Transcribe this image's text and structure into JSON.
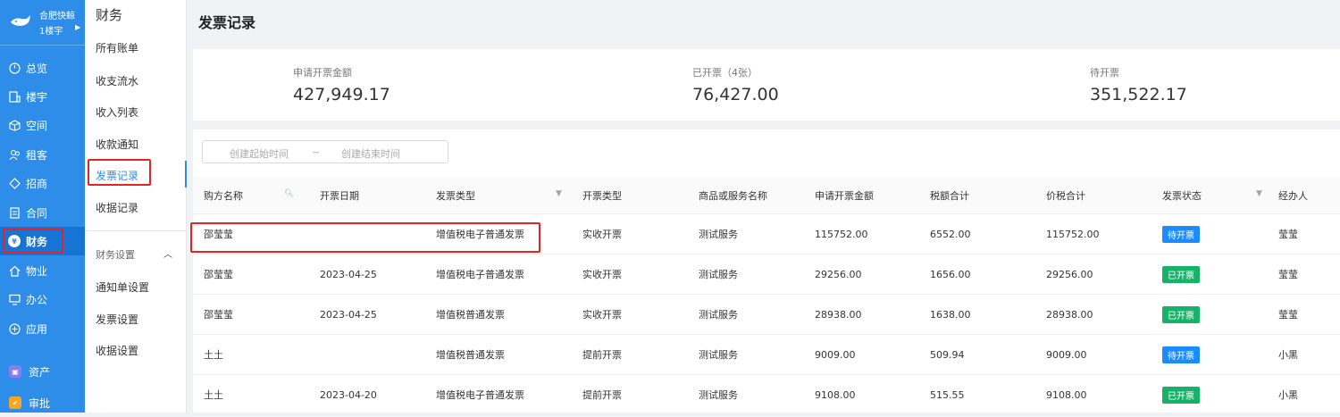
{
  "brand": {
    "name": "合肥快鲸",
    "building": "1楼宇"
  },
  "nav": [
    {
      "label": "总览",
      "icon": "dashboard-icon"
    },
    {
      "label": "楼宇",
      "icon": "building-icon"
    },
    {
      "label": "空间",
      "icon": "cube-icon"
    },
    {
      "label": "租客",
      "icon": "users-icon"
    },
    {
      "label": "招商",
      "icon": "tag-icon"
    },
    {
      "label": "合同",
      "icon": "contract-icon"
    },
    {
      "label": "财务",
      "icon": "finance-icon"
    },
    {
      "label": "物业",
      "icon": "home-icon"
    },
    {
      "label": "办公",
      "icon": "monitor-icon"
    },
    {
      "label": "应用",
      "icon": "apps-icon"
    },
    {
      "label": "资产",
      "icon": "asset-icon"
    },
    {
      "label": "审批",
      "icon": "approve-icon"
    }
  ],
  "submenu": {
    "title": "财务",
    "items": [
      "所有账单",
      "收支流水",
      "收入列表",
      "收款通知",
      "发票记录",
      "收据记录"
    ],
    "active": "发票记录",
    "group_title": "财务设置",
    "group_items": [
      "通知单设置",
      "发票设置",
      "收据设置"
    ]
  },
  "page": {
    "title": "发票记录"
  },
  "stats": [
    {
      "label": "申请开票金额",
      "value": "427,949.17"
    },
    {
      "label": "已开票（4张）",
      "value": "76,427.00"
    },
    {
      "label": "待开票",
      "value": "351,522.17"
    }
  ],
  "filter": {
    "start_placeholder": "创建起始时间",
    "separator": "~",
    "end_placeholder": "创建结束时间"
  },
  "table": {
    "columns": [
      "购方名称",
      "开票日期",
      "发票类型",
      "开票类型",
      "商品或服务名称",
      "申请开票金额",
      "税额合计",
      "价税合计",
      "发票状态",
      "经办人"
    ],
    "rows": [
      {
        "buyer": "邵莹莹",
        "date": "",
        "inv_type": "增值税电子普通发票",
        "issue_type": "实收开票",
        "service": "测试服务",
        "amount": "115752.00",
        "tax": "6552.00",
        "total": "115752.00",
        "status": "待开票",
        "handler": "莹莹"
      },
      {
        "buyer": "邵莹莹",
        "date": "2023-04-25",
        "inv_type": "增值税电子普通发票",
        "issue_type": "实收开票",
        "service": "测试服务",
        "amount": "29256.00",
        "tax": "1656.00",
        "total": "29256.00",
        "status": "已开票",
        "handler": "莹莹"
      },
      {
        "buyer": "邵莹莹",
        "date": "2023-04-25",
        "inv_type": "增值税普通发票",
        "issue_type": "实收开票",
        "service": "测试服务",
        "amount": "28938.00",
        "tax": "1638.00",
        "total": "28938.00",
        "status": "已开票",
        "handler": "莹莹"
      },
      {
        "buyer": "土土",
        "date": "",
        "inv_type": "增值税普通发票",
        "issue_type": "提前开票",
        "service": "测试服务",
        "amount": "9009.00",
        "tax": "509.94",
        "total": "9009.00",
        "status": "待开票",
        "handler": "小黑"
      },
      {
        "buyer": "土土",
        "date": "2023-04-20",
        "inv_type": "增值税电子普通发票",
        "issue_type": "提前开票",
        "service": "测试服务",
        "amount": "9108.00",
        "tax": "515.55",
        "total": "9108.00",
        "status": "已开票",
        "handler": "小黑"
      }
    ]
  },
  "colors": {
    "nav_bg": "#2f8dea",
    "accent": "#2f8dea",
    "pending": "#1a8cff",
    "issued": "#17b26a",
    "highlight": "#e22424"
  }
}
